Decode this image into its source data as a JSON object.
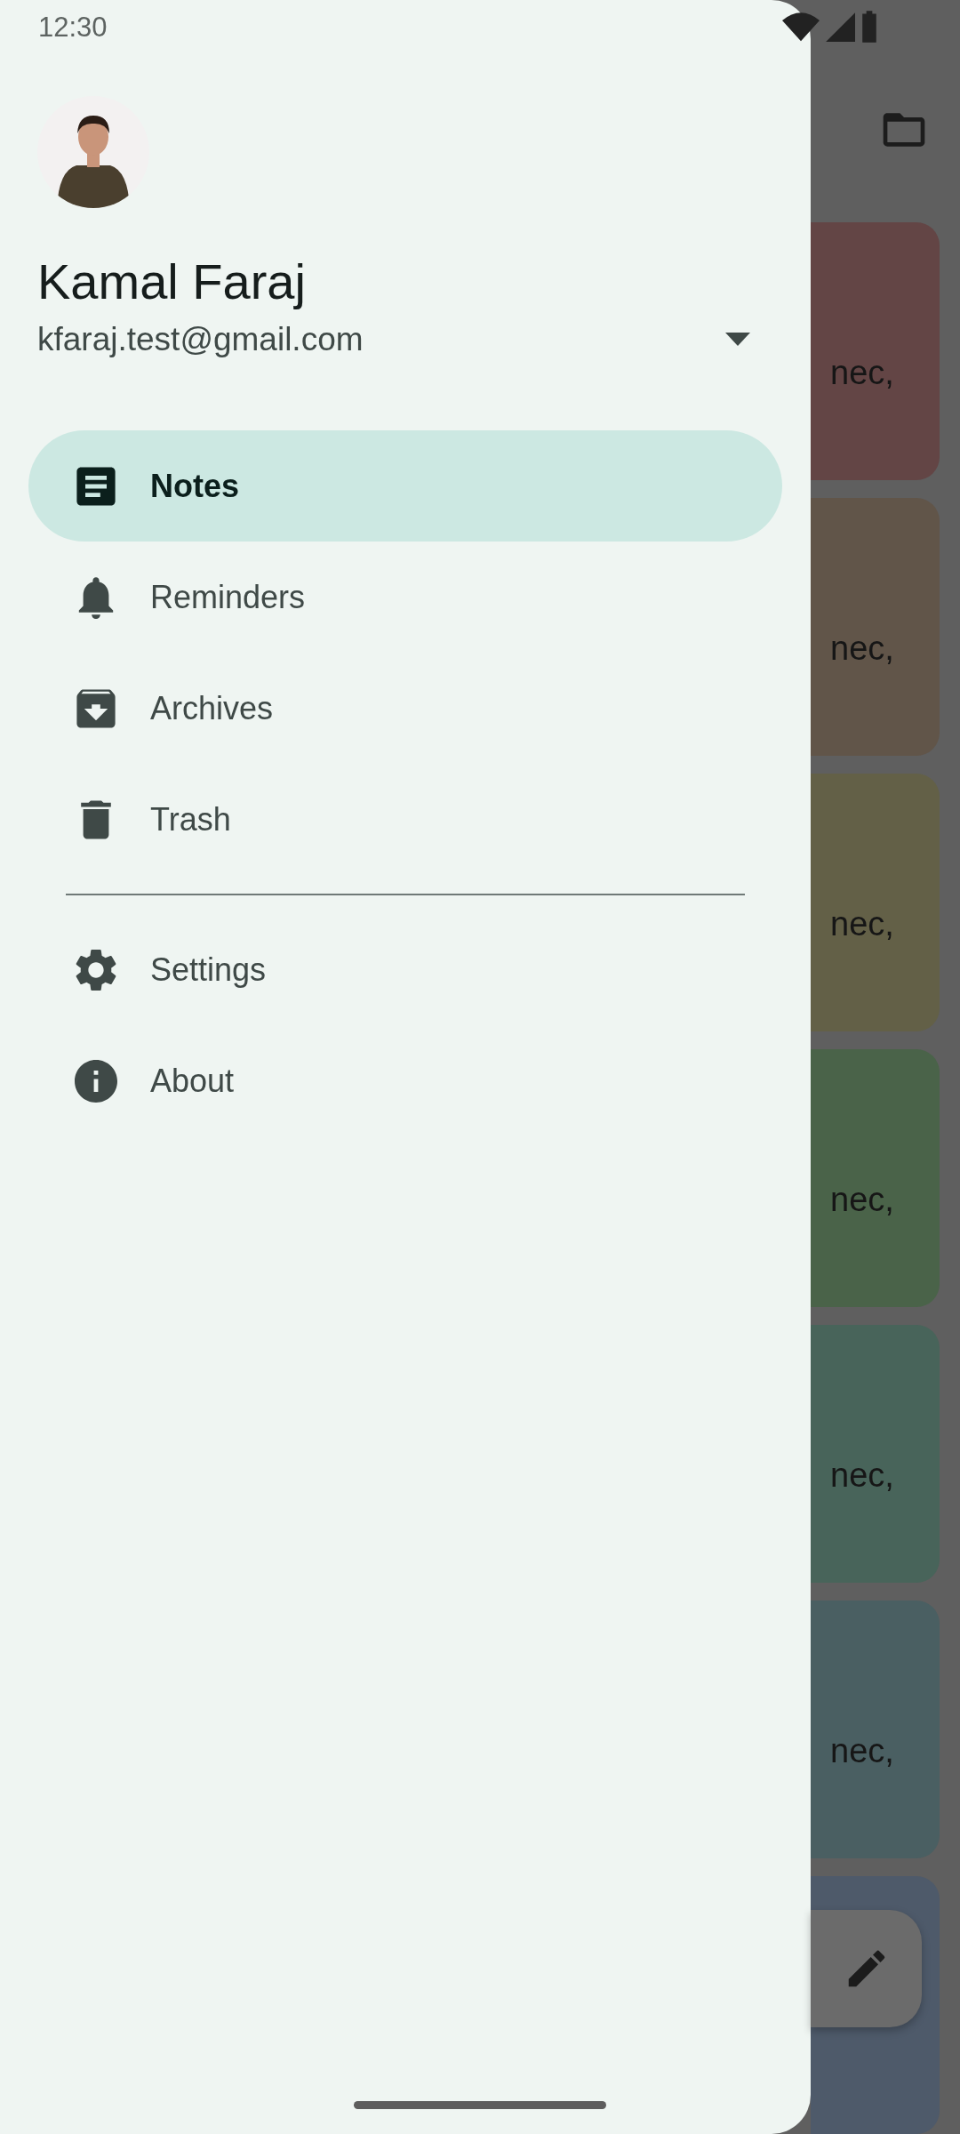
{
  "status_bar": {
    "time": "12:30"
  },
  "account": {
    "name": "Kamal Faraj",
    "email": "kfaraj.test@gmail.com"
  },
  "menu": {
    "sections": [
      {
        "items": [
          {
            "label": "Notes",
            "kind": "notes",
            "selected": true
          },
          {
            "label": "Reminders",
            "kind": "reminders",
            "selected": false
          },
          {
            "label": "Archives",
            "kind": "archives",
            "selected": false
          },
          {
            "label": "Trash",
            "kind": "trash",
            "selected": false
          }
        ]
      },
      {
        "items": [
          {
            "label": "Settings",
            "kind": "settings",
            "selected": false
          },
          {
            "label": "About",
            "kind": "about",
            "selected": false
          }
        ]
      }
    ]
  },
  "notes": [
    {
      "text": "nec,",
      "color": "#634545"
    },
    {
      "text": "nec,",
      "color": "#615549"
    },
    {
      "text": "nec,",
      "color": "#636047"
    },
    {
      "text": "nec,",
      "color": "#4a6349"
    },
    {
      "text": "nec,",
      "color": "#48645a"
    },
    {
      "text": "nec,",
      "color": "#4a5f62"
    },
    {
      "color": "#4e5a6a"
    }
  ]
}
